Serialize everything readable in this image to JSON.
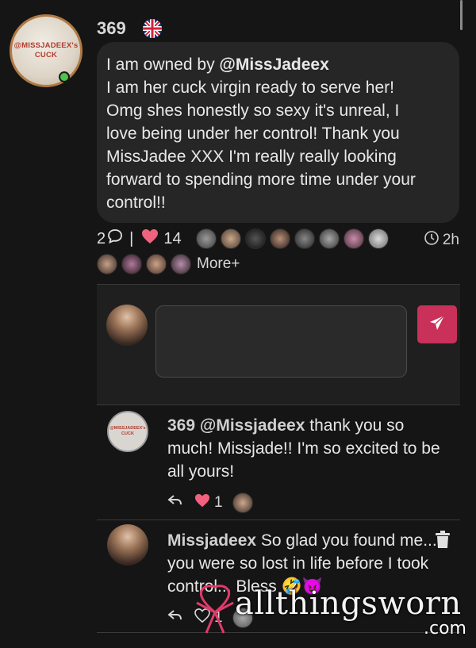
{
  "post": {
    "username": "369",
    "flag_icon": "uk-flag-icon",
    "avatar_text": "@MISSJADEEX's CUCK",
    "mention": "@MissJadeex",
    "lines": [
      "I am owned by ",
      "I am her cuck virgin ready to serve her!",
      "Omg shes honestly so sexy it's unreal, I",
      "love being under her control! Thank you",
      "MissJadee XXX I'm really really looking",
      "forward to spending more time under your",
      "control!!"
    ],
    "comment_count": "2",
    "separator": "|",
    "like_count": "14",
    "time": "2h",
    "more_label": "More+"
  },
  "compose": {
    "placeholder": ""
  },
  "replies": [
    {
      "avatar_text": "@MISSJADEEX's CUCK",
      "author": "369 @Missjadeex",
      "text": " thank you so much! Missjade!! I'm so excited to be all yours!",
      "like_count": "1"
    },
    {
      "author": "Missjadeex",
      "text": " So glad you found me... you were so lost in life before I took control... Bless 🤣😈",
      "like_count": "1"
    }
  ],
  "watermark": {
    "brand": "allthingsworn",
    "domain": ".com"
  },
  "colors": {
    "accent": "#c9305a",
    "heart": "#f0627e",
    "online": "#4fc34a"
  }
}
